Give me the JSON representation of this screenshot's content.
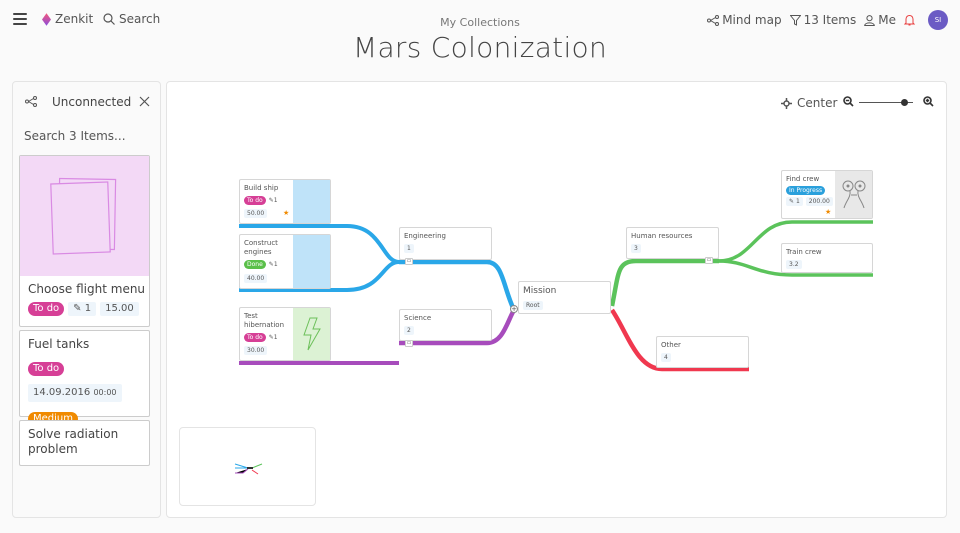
{
  "topbar": {
    "brand": "Zenkit",
    "search_label": "Search",
    "breadcrumb": "My Collections",
    "title": "Mars Colonization",
    "view_label": "Mind map",
    "filter_label": "13 Items",
    "user_label": "Me",
    "avatar_initials": "SI"
  },
  "sidebar": {
    "title": "Unconnected",
    "search_placeholder": "Search 3 Items...",
    "cards": [
      {
        "name": "Choose flight menu",
        "status": "To do",
        "attachments": "1",
        "value": "15.00"
      },
      {
        "name": "Fuel tanks",
        "status": "To do",
        "date": "14.09.2016",
        "time": "00:00",
        "priority": "Medium"
      },
      {
        "name": "Solve radiation problem"
      }
    ]
  },
  "canvas": {
    "center_label": "Center",
    "zoom_level": 0.85,
    "root": {
      "title": "Mission",
      "badge": "Root"
    },
    "branches": {
      "engineering": {
        "title": "Engineering",
        "badge": "1",
        "color": "#2aa7e8"
      },
      "science": {
        "title": "Science",
        "badge": "2",
        "color": "#a74cbc"
      },
      "human_resources": {
        "title": "Human resources",
        "badge": "3",
        "color": "#5bc35b"
      },
      "other": {
        "title": "Other",
        "badge": "4",
        "color": "#f0384f"
      }
    },
    "leaves": {
      "build_ship": {
        "title": "Build ship",
        "status": "To do",
        "attachments": "1",
        "value": "50.00"
      },
      "construct_engines": {
        "title": "Construct engines",
        "status": "Done",
        "attachments": "1",
        "value": "40.00"
      },
      "test_hibernation": {
        "title": "Test hibernation",
        "status": "To do",
        "attachments": "1",
        "value": "30.00"
      },
      "find_crew": {
        "title": "Find crew",
        "status": "In Progress",
        "attachments": "1",
        "value": "200.00"
      },
      "train_crew": {
        "title": "Train crew",
        "badge": "3.2"
      }
    }
  },
  "colors": {
    "todo": "#d63f96",
    "done": "#5bc04a",
    "in_progress": "#2aa0dc",
    "medium": "#f08a00",
    "avatar": "#6b5bc4",
    "bell": "#e84040"
  }
}
